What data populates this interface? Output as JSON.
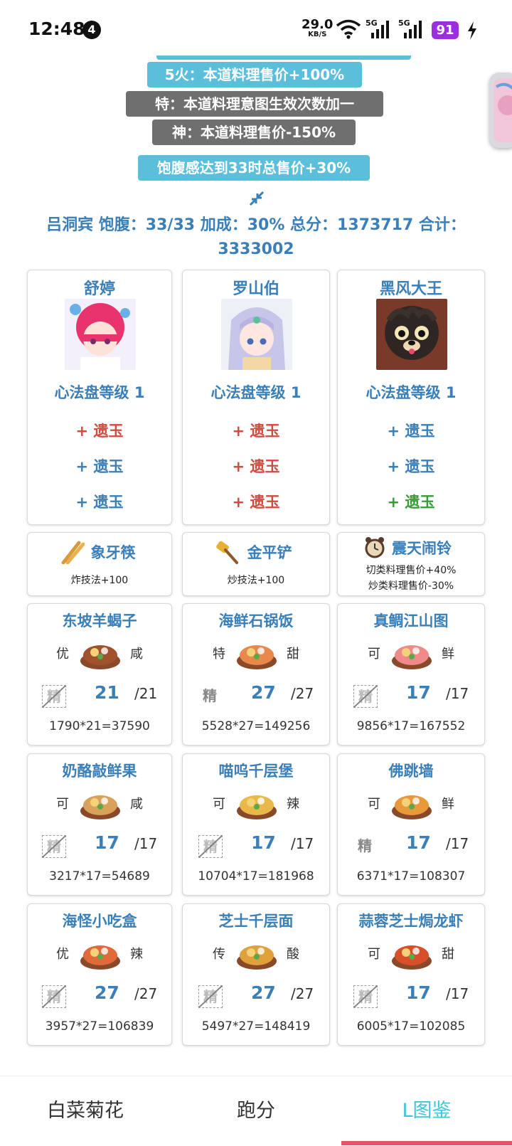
{
  "status_bar": {
    "time": "12:48",
    "notif_count": "4",
    "net_speed": "29.0",
    "net_unit": "KB/S",
    "battery": "91"
  },
  "badges": [
    {
      "text": "5火：本道料理售价+100%",
      "style": "blue"
    },
    {
      "text": "特：本道料理意图生效次数加一",
      "style": "gray"
    },
    {
      "text": "神：本道料理售价-150%",
      "style": "gray"
    },
    {
      "text": "饱腹感达到33时总售价+30%",
      "style": "blue"
    }
  ],
  "summary": {
    "line1": "吕洞宾 饱腹：33/33 加成：30% 总分：1373717 合计：",
    "line2": "3333002"
  },
  "chefs": [
    {
      "name": "舒婷",
      "level": "心法盘等级 1",
      "avatar": "chef-avatar-pink-hair",
      "jades": [
        {
          "text": "+ 遗玉",
          "color": "#d04a3e"
        },
        {
          "text": "+ 遗玉",
          "color": "#3a7fb8"
        },
        {
          "text": "+ 遗玉",
          "color": "#3a7fb8"
        }
      ]
    },
    {
      "name": "罗山伯",
      "level": "心法盘等级 1",
      "avatar": "chef-avatar-silver-hair",
      "jades": [
        {
          "text": "+ 遗玉",
          "color": "#d04a3e"
        },
        {
          "text": "+ 遗玉",
          "color": "#d04a3e"
        },
        {
          "text": "+ 遗玉",
          "color": "#d04a3e"
        }
      ]
    },
    {
      "name": "黑风大王",
      "level": "心法盘等级 1",
      "avatar": "chef-avatar-black-bear",
      "jades": [
        {
          "text": "+ 遗玉",
          "color": "#3a7fb8"
        },
        {
          "text": "+ 遗玉",
          "color": "#3a7fb8"
        },
        {
          "text": "+ 遗玉",
          "color": "#3a9a3a"
        }
      ]
    }
  ],
  "equips": [
    {
      "name": "象牙筷",
      "icon": "chopsticks-icon",
      "desc": [
        "炸技法+100"
      ]
    },
    {
      "name": "金平铲",
      "icon": "spatula-icon",
      "desc": [
        "炒技法+100"
      ]
    },
    {
      "name": "震天闹铃",
      "icon": "alarm-clock-icon",
      "desc": [
        "切类料理售价+40%",
        "炒类料理售价-30%"
      ]
    }
  ],
  "dishes": [
    {
      "name": "东坡羊蝎子",
      "rarity": "优",
      "flavor": "咸",
      "jing": "精",
      "jing_active": false,
      "qty": "21",
      "max": "/21",
      "calc": "1790*21=37590",
      "color": "#a0522d"
    },
    {
      "name": "海鲜石锅饭",
      "rarity": "特",
      "flavor": "甜",
      "jing": "精",
      "jing_active": true,
      "qty": "27",
      "max": "/27",
      "calc": "5528*27=149256",
      "color": "#e8884a"
    },
    {
      "name": "真鲷江山图",
      "rarity": "可",
      "flavor": "鲜",
      "jing": "精",
      "jing_active": false,
      "qty": "17",
      "max": "/17",
      "calc": "9856*17=167552",
      "color": "#f08a8a"
    },
    {
      "name": "奶酪敲鲜果",
      "rarity": "可",
      "flavor": "咸",
      "jing": "精",
      "jing_active": false,
      "qty": "17",
      "max": "/17",
      "calc": "3217*17=54689",
      "color": "#d9a25a"
    },
    {
      "name": "喵呜千层堡",
      "rarity": "可",
      "flavor": "辣",
      "jing": "精",
      "jing_active": false,
      "qty": "17",
      "max": "/17",
      "calc": "10704*17=181968",
      "color": "#e8b84a"
    },
    {
      "name": "佛跳墙",
      "rarity": "可",
      "flavor": "鲜",
      "jing": "精",
      "jing_active": true,
      "qty": "17",
      "max": "/17",
      "calc": "6371*17=108307",
      "color": "#e89a3a"
    },
    {
      "name": "海怪小吃盒",
      "rarity": "优",
      "flavor": "辣",
      "jing": "精",
      "jing_active": false,
      "qty": "27",
      "max": "/27",
      "calc": "3957*27=106839",
      "color": "#e06a3a"
    },
    {
      "name": "芝士千层面",
      "rarity": "传",
      "flavor": "酸",
      "jing": "精",
      "jing_active": false,
      "qty": "27",
      "max": "/27",
      "calc": "5497*27=148419",
      "color": "#e0a03a"
    },
    {
      "name": "蒜蓉芝士焗龙虾",
      "rarity": "可",
      "flavor": "甜",
      "jing": "精",
      "jing_active": false,
      "qty": "17",
      "max": "/17",
      "calc": "6005*17=102085",
      "color": "#d8502a"
    }
  ],
  "nav": {
    "tabs": [
      "白菜菊花",
      "跑分",
      "L图鉴"
    ],
    "active_index": 2,
    "active_color": "#3ec6d6"
  }
}
